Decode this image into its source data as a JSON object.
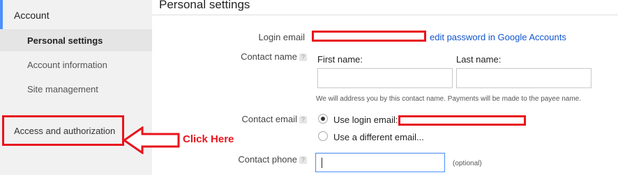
{
  "sidebar": {
    "section_title": "Account",
    "items": [
      {
        "label": "Personal settings",
        "selected": true
      },
      {
        "label": "Account information",
        "selected": false
      },
      {
        "label": "Site management",
        "selected": false
      }
    ],
    "access_item": {
      "label": "Access and authorization"
    }
  },
  "annotation": {
    "text": "Click Here",
    "color": "#e8141c"
  },
  "main": {
    "title": "Personal settings",
    "login_email": {
      "label": "Login email",
      "link": "edit password in Google Accounts"
    },
    "contact_name": {
      "label": "Contact name",
      "first_name_label": "First name:",
      "last_name_label": "Last name:",
      "first_name_value": "",
      "last_name_value": "",
      "hint": "We will address you by this contact name. Payments will be made to the payee name."
    },
    "contact_email": {
      "label": "Contact email",
      "options": [
        {
          "label": "Use login email:",
          "checked": true
        },
        {
          "label": "Use a different email...",
          "checked": false
        }
      ]
    },
    "contact_phone": {
      "label": "Contact phone",
      "value": "",
      "optional": "(optional)"
    }
  },
  "icons": {
    "help": "help-icon",
    "radio": "radio-button"
  },
  "colors": {
    "accent": "#4d90fe",
    "link": "#1155cc",
    "highlight": "#e8141c",
    "sidebar_bg": "#f1f1f1"
  }
}
